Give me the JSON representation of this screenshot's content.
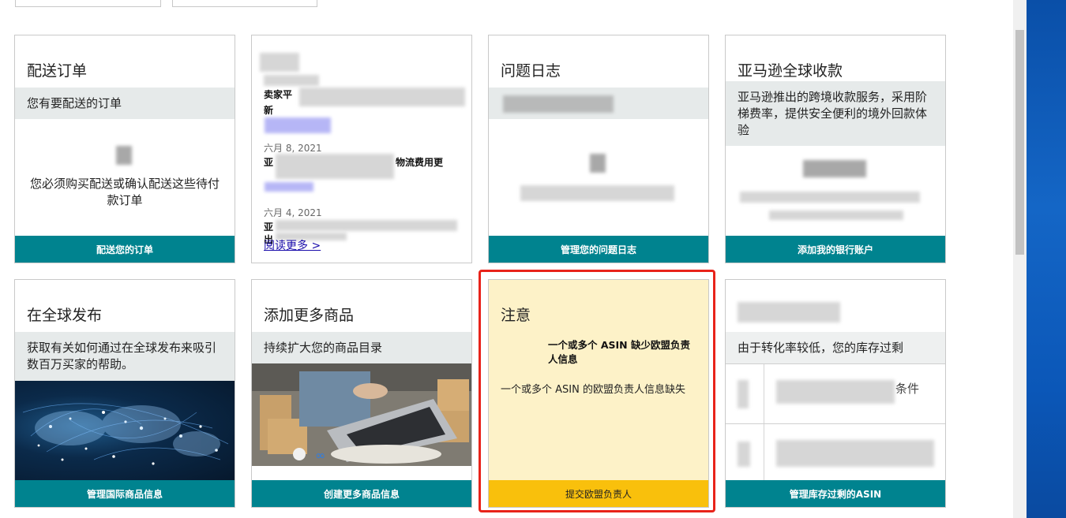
{
  "cards": {
    "ship_orders": {
      "title": "配送订单",
      "subtitle": "您有要配送的订单",
      "message": "您必须购买配送或确认配送这些待付款订单",
      "footer": "配送您的订单"
    },
    "news": {
      "item1_bold": "卖家平",
      "item1_bold2": "新",
      "item2_date": "六月 8, 2021",
      "item2_bold": "亚",
      "item2_bold_tail": "物流费用更",
      "item3_date": "六月 4, 2021",
      "item3_bold": "亚",
      "item3_bold2": "出",
      "read_more": "阅读更多 >"
    },
    "issue_log": {
      "title": "问题日志",
      "footer": "管理您的问题日志"
    },
    "global_payment": {
      "title": "亚马逊全球收款",
      "subtitle": "亚马逊推出的跨境收款服务，采用阶梯费率，提供安全便利的境外回款体验",
      "footer": "添加我的银行账户"
    },
    "global_selling": {
      "title": "在全球发布",
      "subtitle": "获取有关如何通过在全球发布来吸引数百万买家的帮助。",
      "footer": "管理国际商品信息"
    },
    "add_products": {
      "title": "添加更多商品",
      "subtitle": "持续扩大您的商品目录",
      "footer": "创建更多商品信息"
    },
    "notice": {
      "title": "注意",
      "bold_text": "一个或多个 ASIN 缺少欧盟负责人信息",
      "body_text": "一个或多个 ASIN 的欧盟负责人信息缺失",
      "footer": "提交欧盟负责人",
      "bg_color": "#fdf2c8",
      "footer_color": "#f9c00c"
    },
    "excess_inventory": {
      "subtitle": "由于转化率较低，您的库存过剩",
      "row1_tail": "条件",
      "footer": "管理库存过剩的ASIN"
    }
  },
  "colors": {
    "footer_teal": "#00838f",
    "band_gray": "#e6eaea",
    "highlight_red": "#e8231a"
  }
}
